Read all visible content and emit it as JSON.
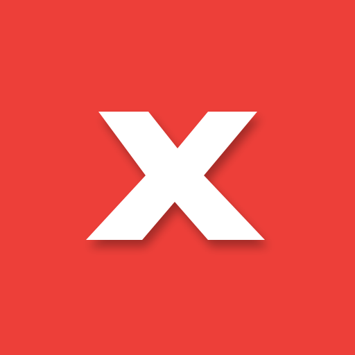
{
  "app_icon": {
    "background_color": "#ED3F39",
    "glyph_color": "#FFFFFF",
    "glyph_icon": "x-mark-icon"
  }
}
